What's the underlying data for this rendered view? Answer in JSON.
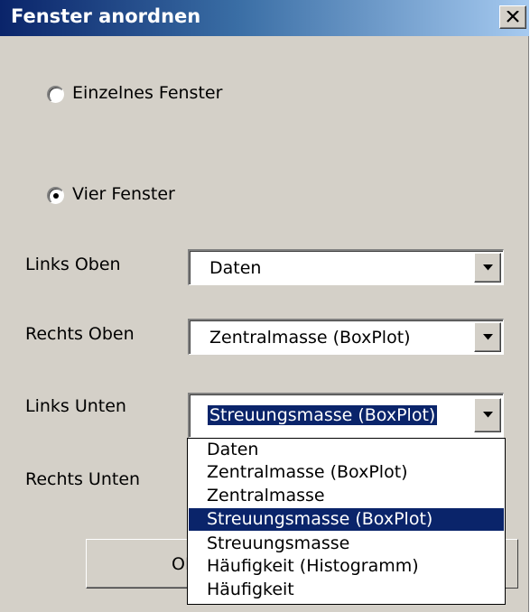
{
  "window": {
    "title": "Fenster anordnen",
    "close_label": "X"
  },
  "layout_options": {
    "single": {
      "label": "Einzelnes Fenster",
      "selected": false
    },
    "four": {
      "label": "Vier Fenster",
      "selected": true
    }
  },
  "fields": [
    {
      "label": "Links Oben",
      "value": "Daten"
    },
    {
      "label": "Rechts Oben",
      "value": "Zentralmasse (BoxPlot)"
    },
    {
      "label": "Links Unten",
      "value": "Streuungsmasse (BoxPlot)"
    },
    {
      "label": "Rechts Unten",
      "value": ""
    }
  ],
  "dropdown": {
    "options": [
      "Daten",
      "Zentralmasse (BoxPlot)",
      "Zentralmasse",
      "Streuungsmasse (BoxPlot)",
      "Streuungsmasse",
      "Häufigkeit (Histogramm)",
      "Häufigkeit"
    ],
    "highlighted_index": 3
  },
  "buttons": {
    "ok_label": "OK"
  },
  "colors": {
    "selection": "#0a246a",
    "dialog_bg": "#d4d0c8"
  }
}
